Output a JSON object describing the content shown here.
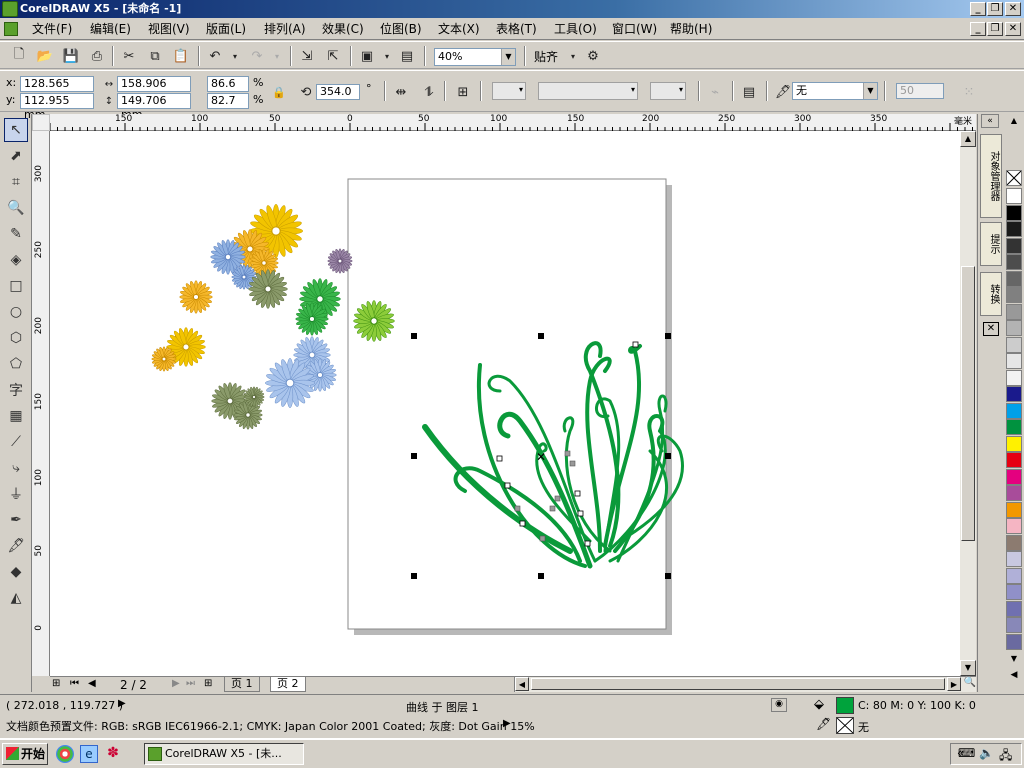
{
  "app": {
    "title": "CorelDRAW X5 - [未命名 -1]",
    "window_min": "_",
    "window_restore": "❐",
    "window_close": "✕"
  },
  "menu": [
    "文件(F)",
    "编辑(E)",
    "视图(V)",
    "版面(L)",
    "排列(A)",
    "效果(C)",
    "位图(B)",
    "文本(X)",
    "表格(T)",
    "工具(O)",
    "窗口(W)",
    "帮助(H)"
  ],
  "standard_toolbar": {
    "zoom_value": "40%",
    "align_label": "贴齐"
  },
  "property_bar": {
    "x_label": "x:",
    "x_value": "128.565 mm",
    "y_label": "y:",
    "y_value": "112.955 mm",
    "width_value": "158.906 mm",
    "height_value": "149.706 mm",
    "scale_x": "86.6",
    "scale_y": "82.7",
    "percent": "%",
    "rotation": "354.0",
    "degree": "°",
    "outline_value": "无",
    "nib_value": "50"
  },
  "ruler": {
    "h_ticks": [
      "150",
      "100",
      "50",
      "0",
      "50",
      "100",
      "150",
      "200",
      "250",
      "300",
      "350"
    ],
    "h_unit": "毫米",
    "v_ticks": [
      "300",
      "250",
      "200",
      "150",
      "100",
      "50",
      "0"
    ]
  },
  "page_nav": {
    "counter": "2 / 2",
    "tabs": [
      "页 1",
      "页 2"
    ],
    "active_tab": 1
  },
  "dockers": {
    "tabs": [
      "对象管理器",
      "提示",
      "转换"
    ]
  },
  "palette": [
    "#ffffff",
    "#000000",
    "#1a1a1a",
    "#333333",
    "#4d4d4d",
    "#666666",
    "#808080",
    "#999999",
    "#b3b3b3",
    "#cccccc",
    "#e6e6e6",
    "#f2f2f2",
    "#1a1a8c",
    "#00a0e9",
    "#00923f",
    "#fff100",
    "#e60012",
    "#e4007f",
    "#a84c9a",
    "#f39800",
    "#f5b5c3",
    "#8c7b70",
    "#c8c8e0",
    "#b0b0d8",
    "#9090c8",
    "#7070b0",
    "#8888b8",
    "#6a6aa0"
  ],
  "status": {
    "coords": "( 272.018 , 119.727 )",
    "object_info": "曲线 于 图层 1",
    "fill_info": "C: 80 M: 0 Y: 100 K: 0",
    "outline_info": "无",
    "fill_color": "#00a33c",
    "color_profile": "文档颜色预置文件: RGB: sRGB IEC61966-2.1; CMYK: Japan Color 2001 Coated; 灰度: Dot Gain 15%"
  },
  "taskbar": {
    "start": "开始",
    "active_window": "CorelDRAW X5 - [未..."
  }
}
